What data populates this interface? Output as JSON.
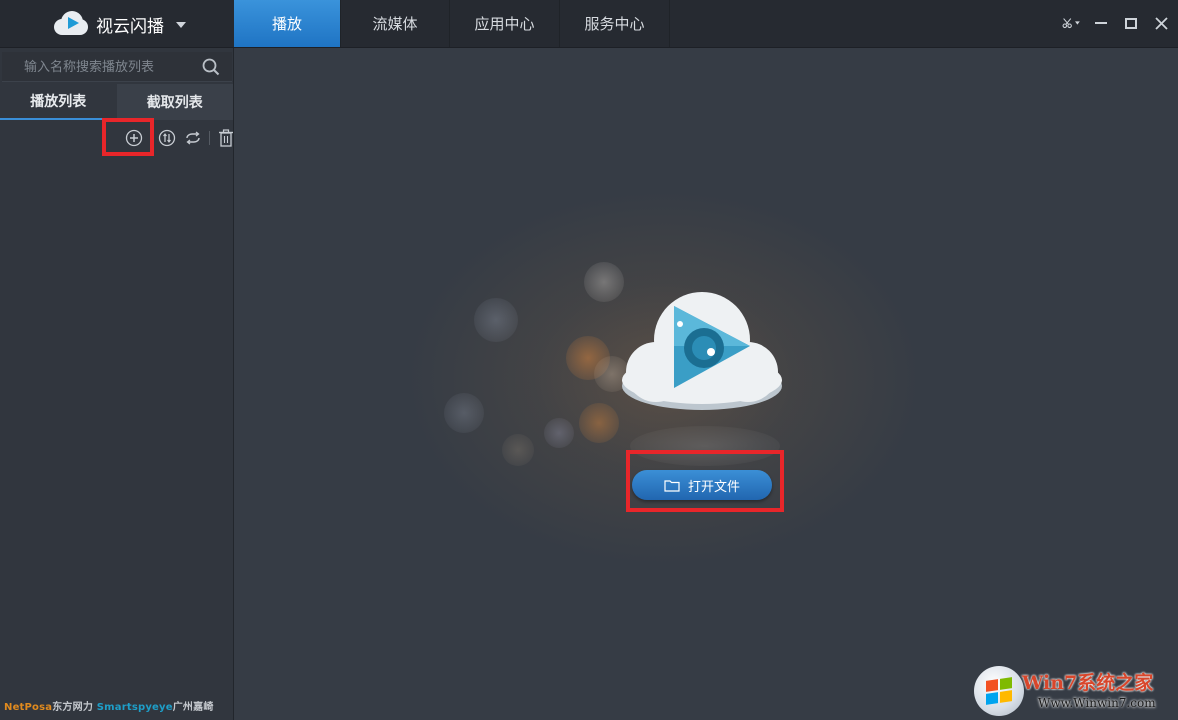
{
  "app": {
    "name": "视云闪播"
  },
  "nav": {
    "tabs": [
      {
        "label": "播放",
        "active": true
      },
      {
        "label": "流媒体",
        "active": false
      },
      {
        "label": "应用中心",
        "active": false
      },
      {
        "label": "服务中心",
        "active": false
      }
    ]
  },
  "sidebar": {
    "search_placeholder": "输入名称搜索播放列表",
    "tabs": [
      {
        "label": "播放列表",
        "active": true
      },
      {
        "label": "截取列表",
        "active": false
      }
    ],
    "tools": [
      "add-icon",
      "sort-icon",
      "loop-icon",
      "delete-icon"
    ],
    "footer": {
      "brand1": "NetPosa",
      "brand1_cn": "东方网力",
      "brand2": "Smartspyeye",
      "brand2_cn": "广州嘉崎"
    }
  },
  "main": {
    "open_file_label": "打开文件"
  },
  "watermark": {
    "title": "Win7系统之家",
    "url": "Www.Winwin7.com"
  },
  "colors": {
    "accent": "#2a7fcc",
    "highlight": "#e8262a",
    "background": "#363c45"
  }
}
